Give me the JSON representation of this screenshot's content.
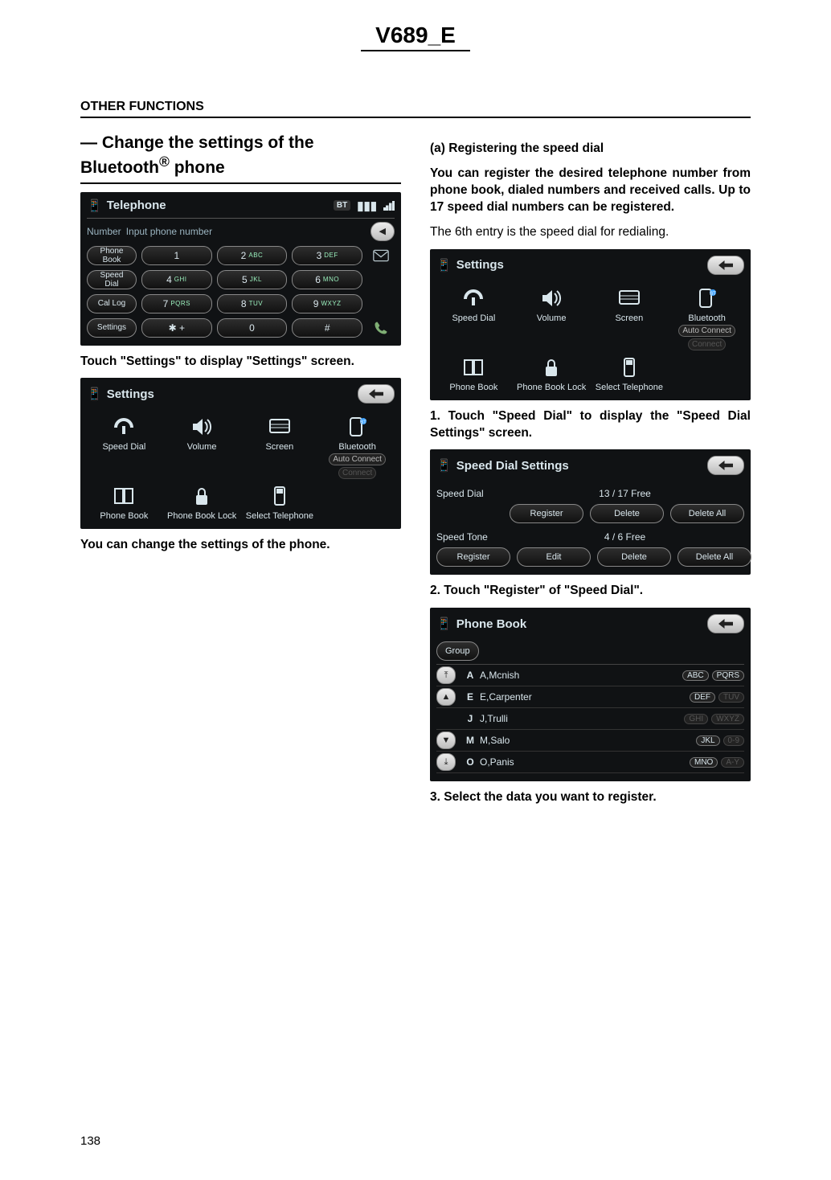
{
  "doc_title": "V689_E",
  "section_header": "OTHER FUNCTIONS",
  "page_number": "138",
  "left_column": {
    "heading_html": "— Change the settings of the Bluetooth® phone",
    "instruction_1": "Touch \"Settings\" to display \"Settings\" screen.",
    "instruction_2": "You can change the settings of the phone."
  },
  "right_column": {
    "sub_heading": "(a)  Registering the speed dial",
    "para_1": "You can register the desired telephone number from phone book, dialed numbers and received calls.   Up to 17 speed dial numbers can be registered.",
    "para_2": "The 6th entry is the speed dial for redialing.",
    "step_1": "1.   Touch \"Speed Dial\" to display the \"Speed Dial Settings\" screen.",
    "step_2": "2.    Touch \"Register\" of \"Speed Dial\".",
    "step_3": "3.   Select the data you want to register."
  },
  "telephone_screen": {
    "title": "Telephone",
    "bt_badge": "BT",
    "number_label": "Number",
    "number_placeholder": "Input phone number",
    "side_buttons": [
      "Phone Book",
      "Speed Dial",
      "Cal Log",
      "Settings"
    ],
    "keys": [
      {
        "n": "1",
        "s": ""
      },
      {
        "n": "2",
        "s": "ABC"
      },
      {
        "n": "3",
        "s": "DEF"
      },
      {
        "n": "4",
        "s": "GHI"
      },
      {
        "n": "5",
        "s": "JKL"
      },
      {
        "n": "6",
        "s": "MNO"
      },
      {
        "n": "7",
        "s": "PQRS"
      },
      {
        "n": "8",
        "s": "TUV"
      },
      {
        "n": "9",
        "s": "WXYZ"
      },
      {
        "n": "✱ +",
        "s": ""
      },
      {
        "n": "0",
        "s": ""
      },
      {
        "n": "#",
        "s": ""
      }
    ]
  },
  "settings_screen": {
    "title": "Settings",
    "cells": [
      {
        "label": "Speed Dial",
        "icon": "speed-dial"
      },
      {
        "label": "Volume",
        "icon": "volume"
      },
      {
        "label": "Screen",
        "icon": "screen"
      },
      {
        "label": "Bluetooth",
        "icon": "bluetooth",
        "extra": "Auto Connect",
        "extra2": "Connect",
        "extra2_disabled": true
      },
      {
        "label": "Phone Book",
        "icon": "phonebook"
      },
      {
        "label": "Phone Book Lock",
        "icon": "lock"
      },
      {
        "label": "Select Telephone",
        "icon": "select-tel"
      }
    ]
  },
  "speed_dial_settings": {
    "title": "Speed Dial Settings",
    "rows": [
      {
        "label": "Speed Dial",
        "meta": "13 / 17  Free",
        "buttons": [
          "Register",
          "Delete",
          "Delete All"
        ]
      },
      {
        "label": "Speed Tone",
        "meta": "4 / 6  Free",
        "buttons": [
          "Register",
          "Edit",
          "Delete",
          "Delete All"
        ]
      }
    ]
  },
  "phone_book_screen": {
    "title": "Phone Book",
    "tab": "Group",
    "rows": [
      {
        "nav": "⤒",
        "letter": "A",
        "name": "A,Mcnish",
        "alpha": [
          "ABC",
          "PQRS"
        ],
        "muted": [
          false,
          false
        ]
      },
      {
        "nav": "▲",
        "letter": "E",
        "name": "E,Carpenter",
        "alpha": [
          "DEF",
          "TUV"
        ],
        "muted": [
          false,
          true
        ]
      },
      {
        "nav": "",
        "letter": "J",
        "name": "J,Trulli",
        "alpha": [
          "GHI",
          "WXYZ"
        ],
        "muted": [
          true,
          true
        ]
      },
      {
        "nav": "▼",
        "letter": "M",
        "name": "M,Salo",
        "alpha": [
          "JKL",
          "0-9"
        ],
        "muted": [
          false,
          true
        ]
      },
      {
        "nav": "⤓",
        "letter": "O",
        "name": "O,Panis",
        "alpha": [
          "MNO",
          "A-Y"
        ],
        "muted": [
          false,
          true
        ]
      }
    ]
  }
}
